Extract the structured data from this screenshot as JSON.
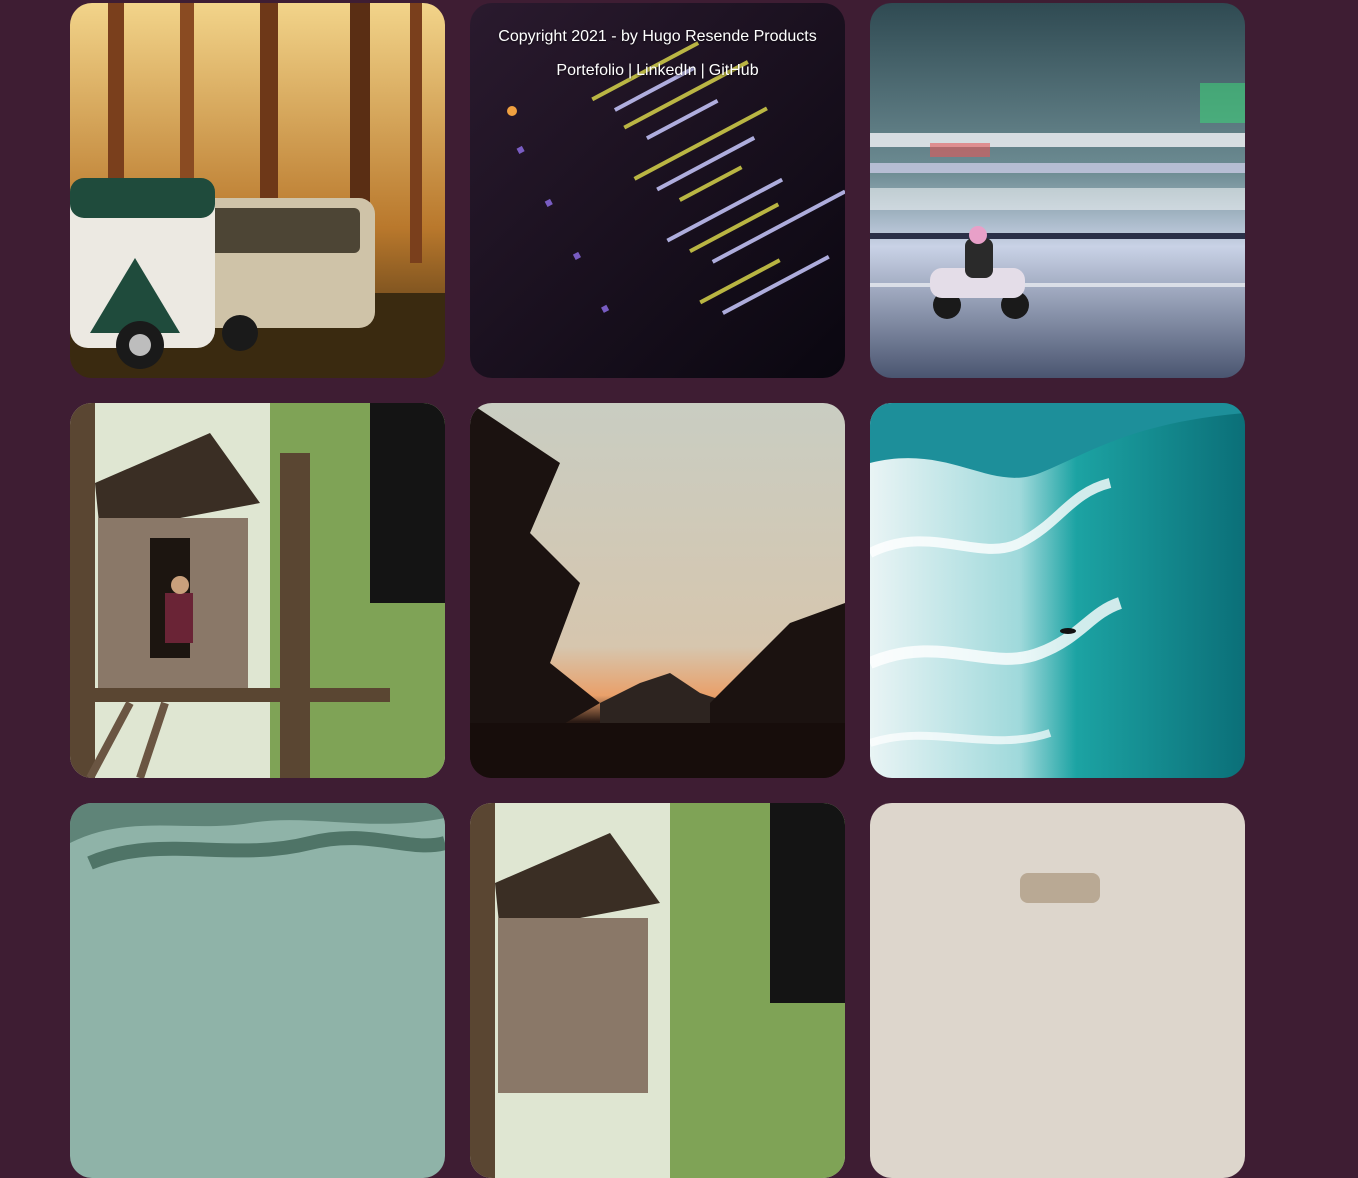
{
  "footer": {
    "copyright": "Copyright 2021 - by Hugo Resende Products",
    "links": [
      "Portefolio",
      "LinkedIn",
      "GitHub"
    ],
    "separator": "|"
  },
  "colors": {
    "background": "#3e1d33",
    "text": "#ffffff"
  },
  "gallery": {
    "photos": [
      {
        "subject": "vans-in-forest-photo"
      },
      {
        "subject": "code-screen-photo"
      },
      {
        "subject": "scooter-rider-photo"
      },
      {
        "subject": "treehouse-photo"
      },
      {
        "subject": "sunset-forest-photo"
      },
      {
        "subject": "ocean-wave-photo"
      },
      {
        "subject": "misty-trees-photo"
      },
      {
        "subject": "treehouse-photo"
      },
      {
        "subject": "interior-photo"
      }
    ]
  }
}
